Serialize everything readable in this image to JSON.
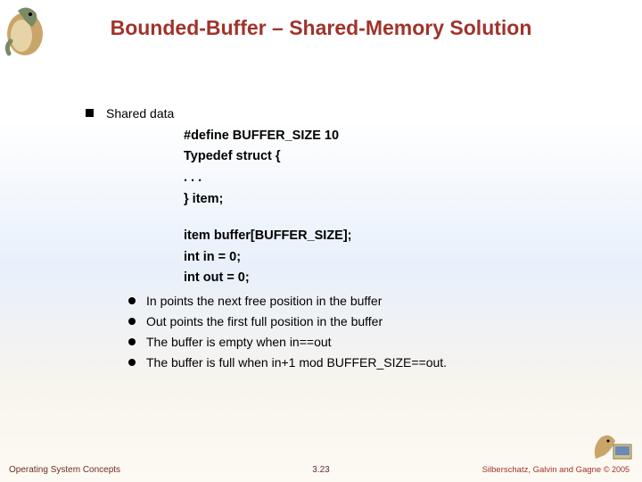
{
  "title": "Bounded-Buffer – Shared-Memory Solution",
  "heading": "Shared data",
  "code": {
    "l1": "#define BUFFER_SIZE 10",
    "l2": "Typedef struct {",
    "l3": " . . .",
    "l4": "} item;",
    "l5": "item buffer[BUFFER_SIZE];",
    "l6": "int in = 0;",
    "l7": "int out = 0;"
  },
  "bullets": {
    "b1": "In points the next free position in the buffer",
    "b2": "Out points the first full position in the buffer",
    "b3": "The buffer is empty when in==out",
    "b4": "The buffer is full when in+1 mod BUFFER_SIZE==out."
  },
  "footer": {
    "left": "Operating System Concepts",
    "center": "3.23",
    "right_authors": "Silberschatz, Galvin and Gagne ",
    "right_copy": "© 2005"
  }
}
